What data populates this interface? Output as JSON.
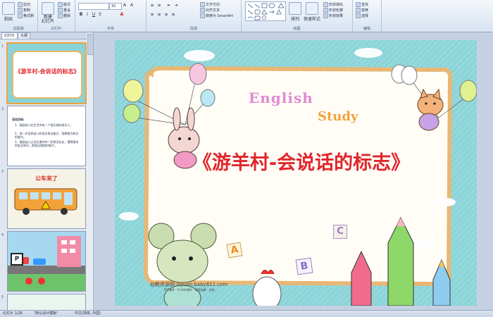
{
  "ribbon": {
    "clipboard": {
      "label": "剪贴板",
      "paste": "粘贴",
      "cut": "剪切",
      "copy": "复制",
      "format_painter": "格式刷"
    },
    "slides": {
      "label": "幻灯片",
      "new_slide": "新建\n幻灯片",
      "layout": "版式",
      "reset": "重设",
      "delete": "删除"
    },
    "font": {
      "label": "字体",
      "font_size": "32"
    },
    "paragraph": {
      "label": "段落",
      "text_direction": "文字方向",
      "align_text": "对齐文本",
      "smartart": "转换为 SmartArt"
    },
    "drawing": {
      "label": "绘图",
      "arrange": "排列",
      "quick_styles": "快速样式",
      "shape_fill": "形状填充",
      "shape_outline": "形状轮廓",
      "shape_effects": "形状效果"
    },
    "editing": {
      "label": "编辑",
      "find": "查找",
      "replace": "替换",
      "select": "选择"
    }
  },
  "panel": {
    "tab_slides": "幻灯片",
    "tab_outline": "大纲"
  },
  "thumbs": {
    "t1": {
      "num": "1",
      "title": "《游羊村-会说话的标志》"
    },
    "t2": {
      "num": "2",
      "heading": "活动目标:",
      "lines": [
        "1、鼓励幼儿在生活中有一个很乐观的老乐人。",
        "2、进一步培养幼儿的语言表达能力、观察能力和分析能力。",
        "3、激励幼儿认识交通中的一些常见标志，懂得基本的安全知识，提高自我保护能力。"
      ]
    },
    "t3": {
      "num": "3",
      "title": "公车来了"
    },
    "t4": {
      "num": "4",
      "p_sign": "P"
    },
    "t5": {
      "num": "5"
    }
  },
  "slide": {
    "title": "《游羊村-会说话的标志》",
    "english": "English",
    "study": "Study",
    "block_a": "A",
    "block_b": "B",
    "block_c": "C",
    "watermark": "幼教资源网 ziyuan.baby611.com",
    "watermark_sub": "PPT课件 · FLASH课件 · 教案故事 · 试卷"
  },
  "status": {
    "slide": "幻灯片 1/26",
    "theme": "\"默认设计模板\"",
    "lang": "中文(简体, 中国)"
  },
  "colors": {
    "title_red": "#e0262c",
    "slide_bg": "#8ad3d8",
    "ribbon_bg": "#dbe5f1"
  }
}
